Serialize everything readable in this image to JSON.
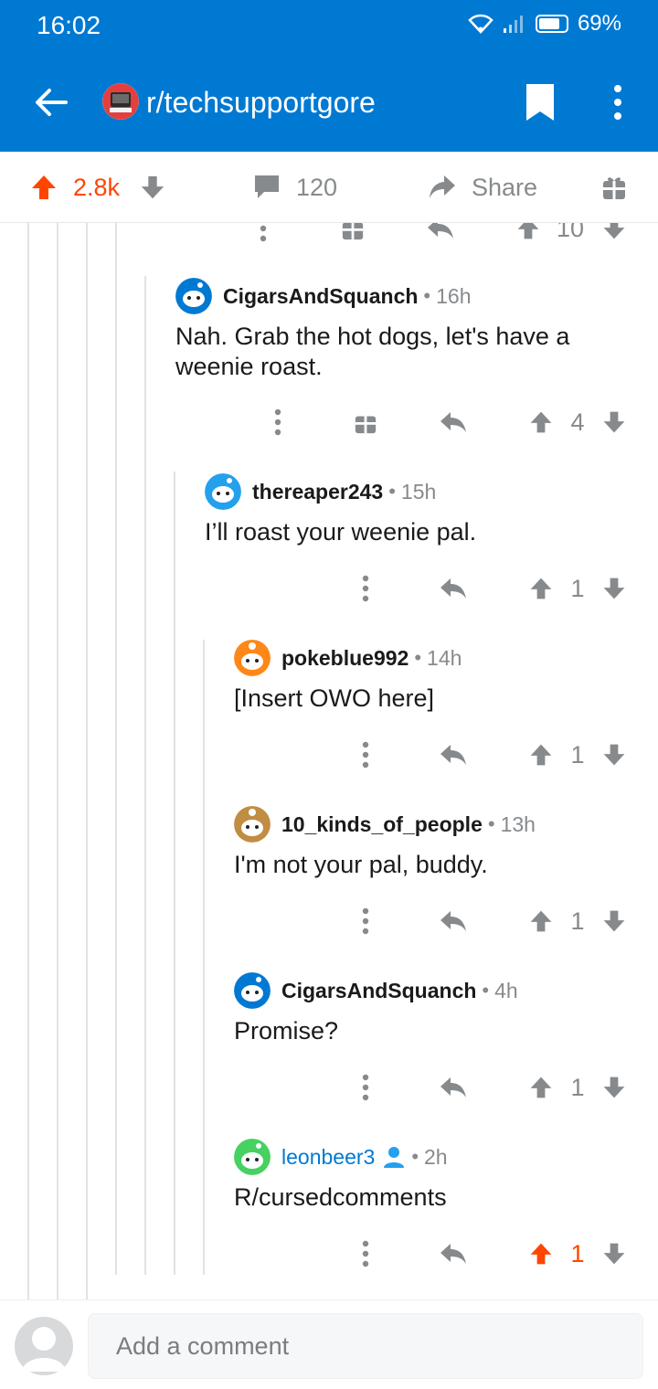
{
  "status_bar": {
    "time": "16:02",
    "battery": "69%"
  },
  "header": {
    "subreddit": "r/techsupportgore"
  },
  "post_actions": {
    "votes": "2.8k",
    "comments": "120",
    "share": "Share"
  },
  "partial_row": {
    "score": "10"
  },
  "comments": [
    {
      "user": "CigarsAndSquanch",
      "time": "16h",
      "body": "Nah. Grab the hot dogs, let's have a weenie roast.",
      "score": "4",
      "avatar_color": "#0079d3"
    },
    {
      "user": "thereaper243",
      "time": "15h",
      "body": "I’ll roast your weenie pal.",
      "score": "1",
      "avatar_color": "#24a0ed"
    },
    {
      "user": "pokeblue992",
      "time": "14h",
      "body": "[Insert OWO here]",
      "score": "1",
      "avatar_color": "#ff8717"
    },
    {
      "user": "10_kinds_of_people",
      "time": "13h",
      "body": "I'm not your pal, buddy.",
      "score": "1",
      "avatar_color": "#c18d42"
    },
    {
      "user": "CigarsAndSquanch",
      "time": "4h",
      "body": "Promise?",
      "score": "1",
      "avatar_color": "#0079d3"
    },
    {
      "user": "leonbeer3",
      "time": "2h",
      "body": "R/cursedcomments",
      "score": "1",
      "avatar_color": "#46d160",
      "upvoted": true,
      "op": true
    }
  ],
  "composer": {
    "placeholder": "Add a comment"
  },
  "colors": {
    "brand_blue": "#0079d3",
    "upvote_orange": "#ff4500",
    "meta_gray": "#878a8c"
  }
}
